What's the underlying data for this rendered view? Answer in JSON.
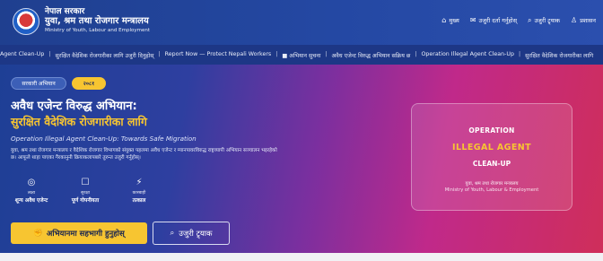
{
  "header": {
    "gov": "नेपाल सरकार",
    "ministry": "युवा, श्रम तथा रोजगार मन्त्रालय",
    "ministry_en": "Ministry of Youth, Labour and Employment",
    "nav": [
      {
        "icon": "home-icon",
        "glyph": "⌂",
        "label": "मुख्य"
      },
      {
        "icon": "report-icon",
        "glyph": "✉",
        "label": "उजुरी दर्ता गर्नुहोस्"
      },
      {
        "icon": "search-icon",
        "glyph": "⌕",
        "label": "उजुरी ट्र्याक"
      },
      {
        "icon": "user-icon",
        "glyph": "♙",
        "label": "प्रशासन"
      }
    ]
  },
  "ticker": [
    "Agent Clean-Up",
    "सुरक्षित वैदेशिक रोजगारीका लागि उजुरी दिनुहोस्",
    "Report Now — Protect Nepali Workers",
    "■ अभियान सुचना",
    "अवैध एजेन्ट विरुद्ध अभियान सक्रिय छ",
    "Operation Illegal Agent Clean-Up",
    "सुरक्षित वैदेशिक रोजगारीका लागि"
  ],
  "hero": {
    "pill_primary": "सरकारी अभियान",
    "pill_secondary": "२०८१",
    "title": "अवैध एजेन्ट विरुद्ध अभियान:",
    "subtitle": "सुरक्षित वैदेशिक रोजगारीका लागि",
    "tagline": "Operation Illegal Agent Clean-Up: Towards Safe Migration",
    "description": "युवा, श्रम तथा रोजगार मन्त्रालय र वैदेशिक रोजगार विभागको संयुक्त पहलमा अवैध एजेन्ट र म्यानपावरविरुद्ध राष्ट्रव्यापी अभियान सञ्चालन भइरहेको छ। आफूले थाहा पाएका गैरकानुनी क्रियाकलापबारे तुरुन्त उजुरी गर्नुहोस्।",
    "stats": [
      {
        "icon": "target-icon",
        "glyph": "◎",
        "small": "लक्ष्य",
        "label": "शून्य अवैध एजेन्ट"
      },
      {
        "icon": "shield-icon",
        "glyph": "☐",
        "small": "सुरक्षा",
        "label": "पूर्ण गोपनीयता"
      },
      {
        "icon": "bolt-icon",
        "glyph": "⚡",
        "small": "कारबाही",
        "label": "तत्काल"
      }
    ],
    "btn_primary": "अभियानमा सहभागी हुनुहोस्",
    "btn_primary_glyph": "✊",
    "btn_secondary": "उजुरी ट्र्याक",
    "btn_secondary_glyph": "⌕"
  },
  "operation_card": {
    "line1": "OPERATION",
    "line2": "ILLEGAL AGENT",
    "line3": "CLEAN-UP",
    "line4": "युवा, श्रम तथा रोजगार मन्त्रालय",
    "line5": "Ministry of Youth, Labour & Employment"
  },
  "colors": {
    "header_bg": "#1f3f8f",
    "ticker_bg": "#1d3786",
    "accent_yellow": "#f7c531",
    "hero_left": "#1e3f95",
    "hero_right": "#cf2e5a"
  }
}
